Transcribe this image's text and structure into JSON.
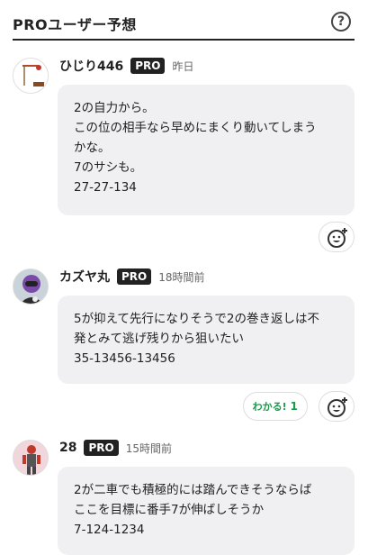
{
  "header": {
    "title": "PROユーザー予想",
    "help_icon": "?"
  },
  "posts": [
    {
      "username": "ひじり446",
      "badge": "PRO",
      "time": "昨日",
      "lines": [
        "2の自力から。",
        "この位の相手なら早めにまくり動いてしまう",
        "かな。",
        "7のサシも。",
        "27-27-134"
      ],
      "avatar_icon": "cane-icon"
    },
    {
      "username": "カズヤ丸",
      "badge": "PRO",
      "time": "18時間前",
      "lines": [
        "5が抑えて先行になりそうで2の巻き返しは不",
        "発とみて逃げ残りから狙いたい",
        "35-13456-13456"
      ],
      "wakaru_label": "わかる!",
      "wakaru_count": "1",
      "avatar_icon": "helmet-rider-icon"
    },
    {
      "username": "28",
      "badge": "PRO",
      "time": "15時間前",
      "lines": [
        "2が二車でも積極的には踏んできそうならば",
        "ここを目標に番手7が伸ばしそうか",
        "7-124-1234"
      ],
      "avatar_icon": "figure-icon"
    }
  ],
  "colors": {
    "bubble_bg": "#f0f0f3",
    "badge_bg": "#222222",
    "wakaru_green": "#1a9a4a"
  }
}
